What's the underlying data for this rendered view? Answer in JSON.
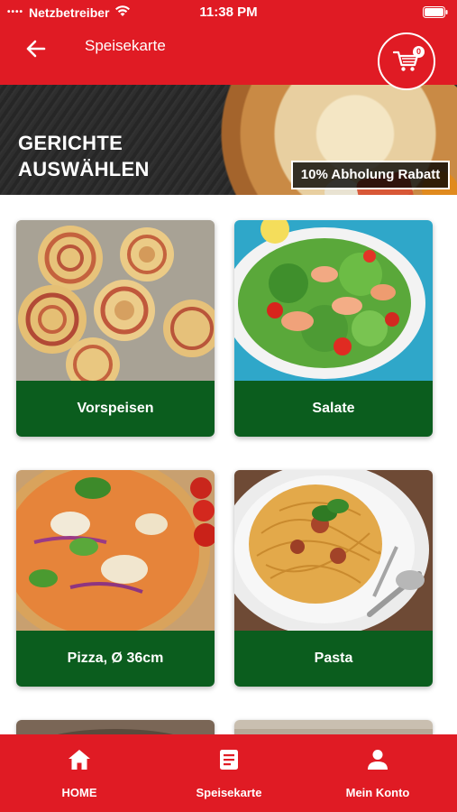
{
  "status_bar": {
    "carrier": "Netzbetreiber",
    "time": "11:38 PM"
  },
  "header": {
    "title": "Speisekarte",
    "cart_count": "0"
  },
  "hero": {
    "title_line1": "GERICHTE",
    "title_line2": "AUSWÄHLEN",
    "badge": "10% Abholung Rabatt"
  },
  "categories": [
    {
      "label": "Vorspeisen"
    },
    {
      "label": "Salate"
    },
    {
      "label": "Pizza, Ø 36cm"
    },
    {
      "label": "Pasta"
    }
  ],
  "bottom_nav": {
    "items": [
      {
        "label": "HOME",
        "icon": "home-icon"
      },
      {
        "label": "Speisekarte",
        "icon": "menu-list-icon"
      },
      {
        "label": "Mein Konto",
        "icon": "user-icon"
      }
    ]
  },
  "colors": {
    "primary_red": "#e01b24",
    "label_green": "#0b5d1e",
    "text_white": "#ffffff"
  }
}
